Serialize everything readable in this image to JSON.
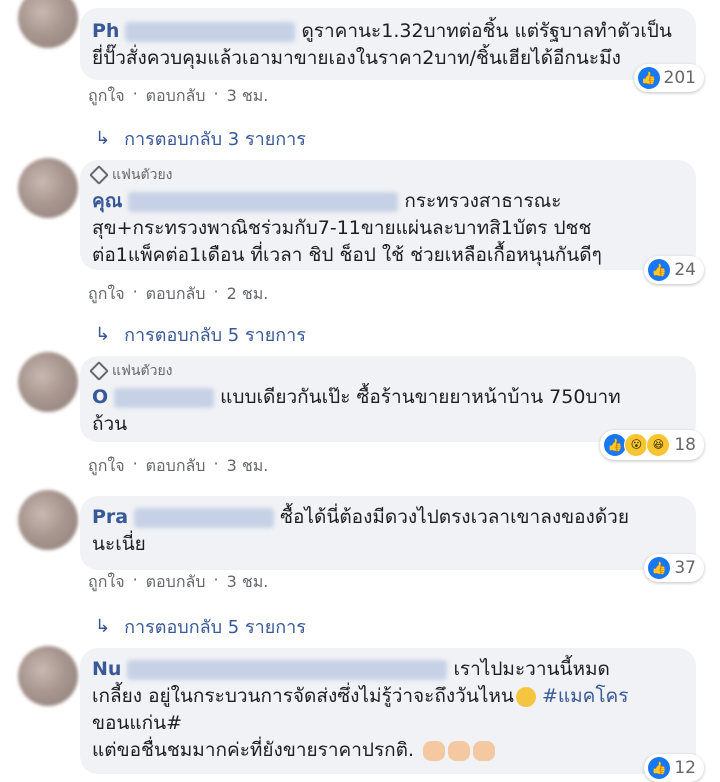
{
  "labels": {
    "like": "ถูกใจ",
    "reply": "ตอบกลับ",
    "dot": "·",
    "fan": "แฟนตัวยง"
  },
  "colors": {
    "link": "#385898",
    "bubble": "#f0f2f5",
    "like": "#1877f2"
  },
  "comments": [
    {
      "name": "Ph",
      "text_lines": [
        "ดูราคานะ1.32บาทต่อชิ้น แต่รัฐบาลทำตัวเป็น",
        "ยี่ปั๊วสั่งควบคุมแล้วเอามาขายเองในราคา2บาท/ชิ้นเฮียได้อีกนะมึง"
      ],
      "reactions": {
        "count": "201",
        "icons": [
          "like-icon"
        ]
      },
      "time": "3 ชม.",
      "replies": "การตอบกลับ 3 รายการ"
    },
    {
      "badge": "แฟนตัวยง",
      "name": "คุณ",
      "text_lines": [
        "กระทรวงสาธารณะ",
        "สุข+กระทรวงพาณิชร่วมกับ7-11ขายแผ่นละบาทสิ1บัตร ปชช",
        "ต่อ1แพ็คต่อ1เดือน ที่เวลา ชิป ช็อป ใช้ ช่วยเหลือเกื้อหนุนกันดีๆ"
      ],
      "reactions": {
        "count": "24",
        "icons": [
          "like-icon"
        ]
      },
      "time": "2 ชม.",
      "replies": "การตอบกลับ 5 รายการ"
    },
    {
      "badge": "แฟนตัวยง",
      "name": "O",
      "text_lines": [
        "แบบเดียวกันเป๊ะ ซื้อร้านขายยาหน้าบ้าน 750บาท",
        "ถ้วน"
      ],
      "reactions": {
        "count": "18",
        "icons": [
          "like-icon",
          "wow-icon",
          "haha-icon"
        ]
      },
      "time": "3 ชม."
    },
    {
      "name": "Pra",
      "text_lines": [
        "ซื้อได้นี่ต้องมีดวงไปตรงเวลาเขาลงของด้วย",
        "นะเนี่ย"
      ],
      "reactions": {
        "count": "37",
        "icons": [
          "like-icon"
        ]
      },
      "time": "3 ชม.",
      "replies": "การตอบกลับ 5 รายการ"
    },
    {
      "name": "Nu",
      "text_lines": [
        "เราไปมะวานนี้หมด",
        "เกลี้ยง อยู่ในกระบวนการจัดส่งซึ่งไม่รู้ว่าจะถึงวันไหน",
        "ขอนแก่น#",
        "แต่ขอชื่นชมมากค่ะที่ยังขายราคาปรกติ."
      ],
      "hashtags": [
        "#แมคโคร"
      ],
      "reactions": {
        "count": "12",
        "icons": [
          "like-icon"
        ]
      }
    }
  ]
}
